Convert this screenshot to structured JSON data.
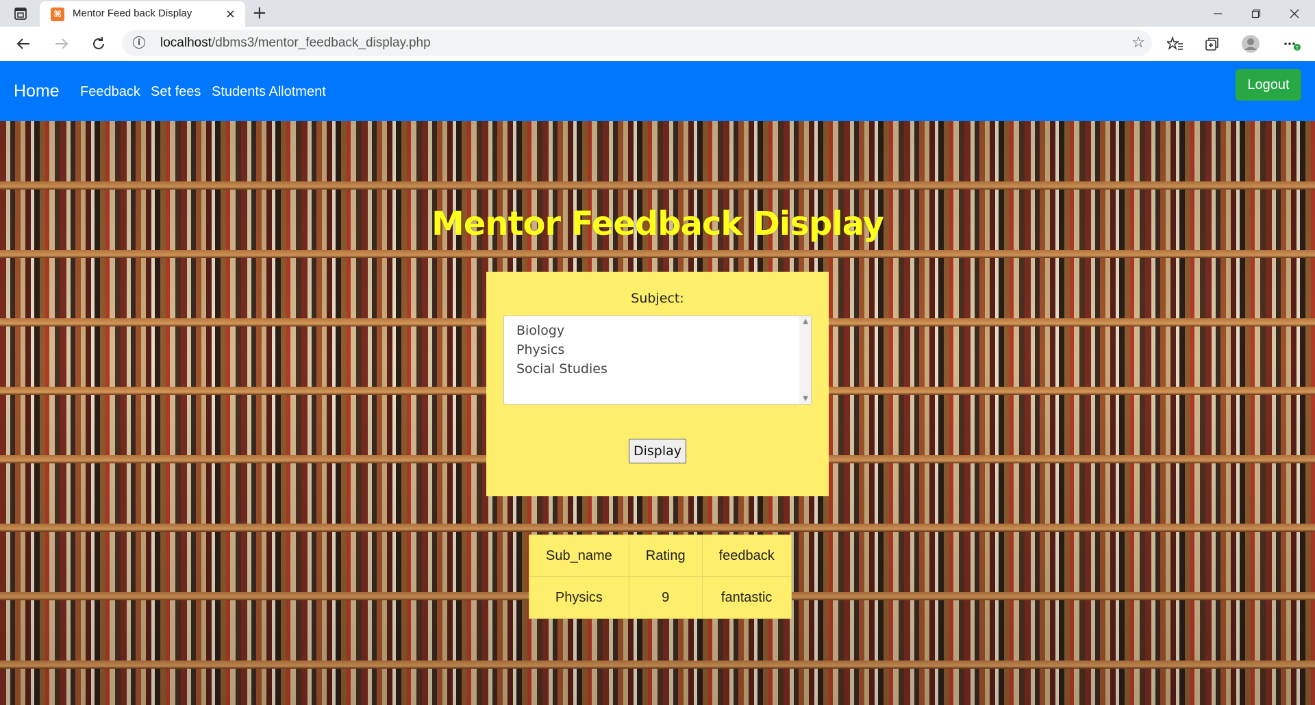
{
  "browser": {
    "tab_title": "Mentor Feed back Display",
    "tab_close": "×",
    "new_tab": "+",
    "url_host": "localhost",
    "url_path": "/dbms3/mentor_feedback_display.php",
    "icons": [
      "tab-actions-icon",
      "back-icon",
      "forward-icon",
      "refresh-icon",
      "info-icon",
      "favorite-star-icon",
      "favorites-icon",
      "collections-icon",
      "profile-icon",
      "more-icon",
      "minimize-icon",
      "restore-icon",
      "close-icon"
    ]
  },
  "navbar": {
    "brand": "Home",
    "links": [
      "Feedback",
      "Set fees",
      "Students Allotment"
    ],
    "logout": "Logout",
    "color": "#0077fc",
    "logout_color": "#28a745"
  },
  "main": {
    "title": "Mentor Feedback Display",
    "title_color": "#ffff1c",
    "form": {
      "label": "Subject:",
      "options": [
        "Biology",
        "Physics",
        "Social Studies"
      ],
      "button": "Display",
      "card_color": "#fdee6b"
    },
    "table": {
      "headers": [
        "Sub_name",
        "Rating",
        "feedback"
      ],
      "rows": [
        [
          "Physics",
          "9",
          "fantastic"
        ]
      ]
    }
  }
}
